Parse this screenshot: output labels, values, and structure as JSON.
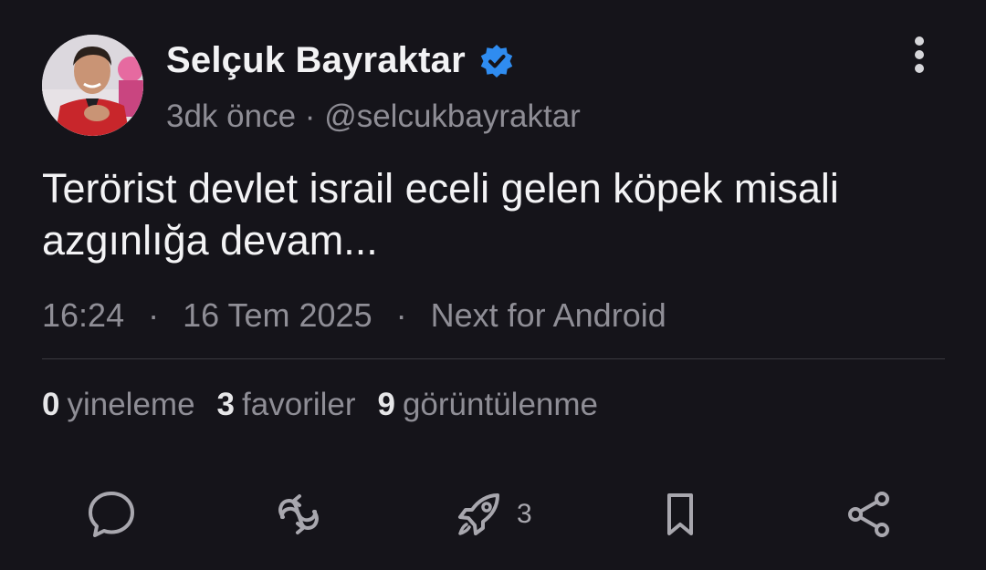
{
  "author": {
    "name": "Selçuk Bayraktar",
    "time_ago": "3dk önce",
    "separator": "·",
    "handle": "@selcukbayraktar"
  },
  "post": {
    "text_line1": "Terörist devlet israil eceli gelen köpek misali",
    "text_line2": "azgınlığa devam..."
  },
  "info": {
    "time": "16:24",
    "date": "16 Tem 2025",
    "source": "Next for Android",
    "separator": "·"
  },
  "stats": {
    "reposts_count": "0",
    "reposts_label": "yineleme",
    "favorites_count": "3",
    "favorites_label": "favoriler",
    "views_count": "9",
    "views_label": "görüntülenme"
  },
  "actions": {
    "reply_icon": "speech-bubble-icon",
    "repost_icon": "repost-icon",
    "boost_icon": "rocket-icon",
    "boost_count": "3",
    "bookmark_icon": "bookmark-icon",
    "share_icon": "share-icon"
  },
  "colors": {
    "background": "#15141a",
    "verified": "#2f8cf0",
    "muted": "#8f8e96"
  }
}
